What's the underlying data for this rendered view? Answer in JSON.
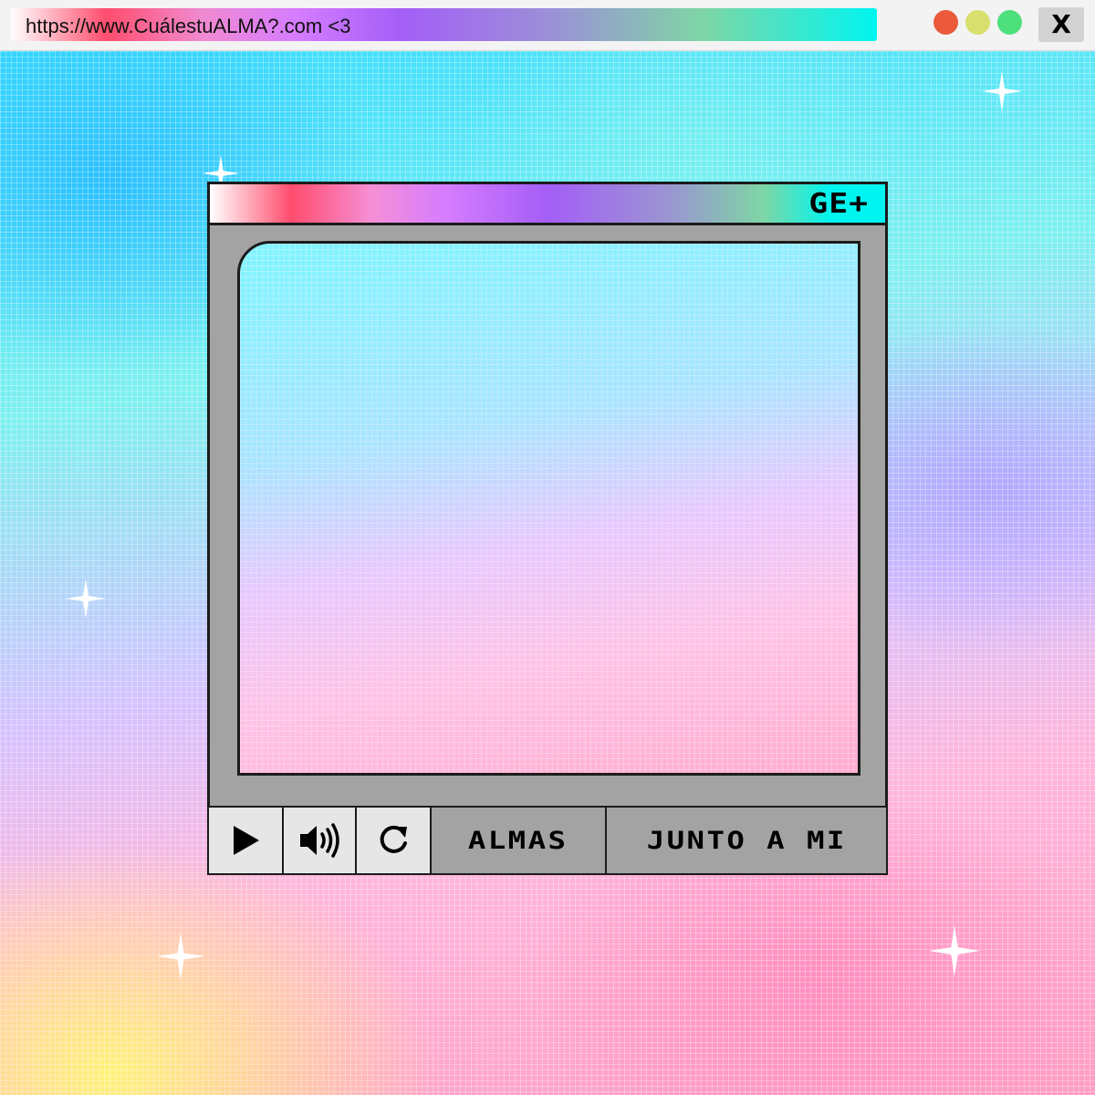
{
  "browser": {
    "url": "https://www.CuálestuALMA?.com <3",
    "close_label": "X",
    "traffic_lights": [
      {
        "name": "close",
        "color": "#eb5a3a"
      },
      {
        "name": "minimize",
        "color": "#d8df6c"
      },
      {
        "name": "maximize",
        "color": "#4fe07e"
      }
    ]
  },
  "player": {
    "title": "GE+",
    "controls": {
      "play_icon": "play-icon",
      "volume_icon": "volume-icon",
      "replay_icon": "replay-icon",
      "label_1": "ALMAS",
      "label_2": "JUNTO A MI"
    }
  },
  "colors": {
    "frame_gray": "#a3a3a3",
    "button_gray": "#e6e6e6",
    "outline": "#1b1b1b"
  }
}
